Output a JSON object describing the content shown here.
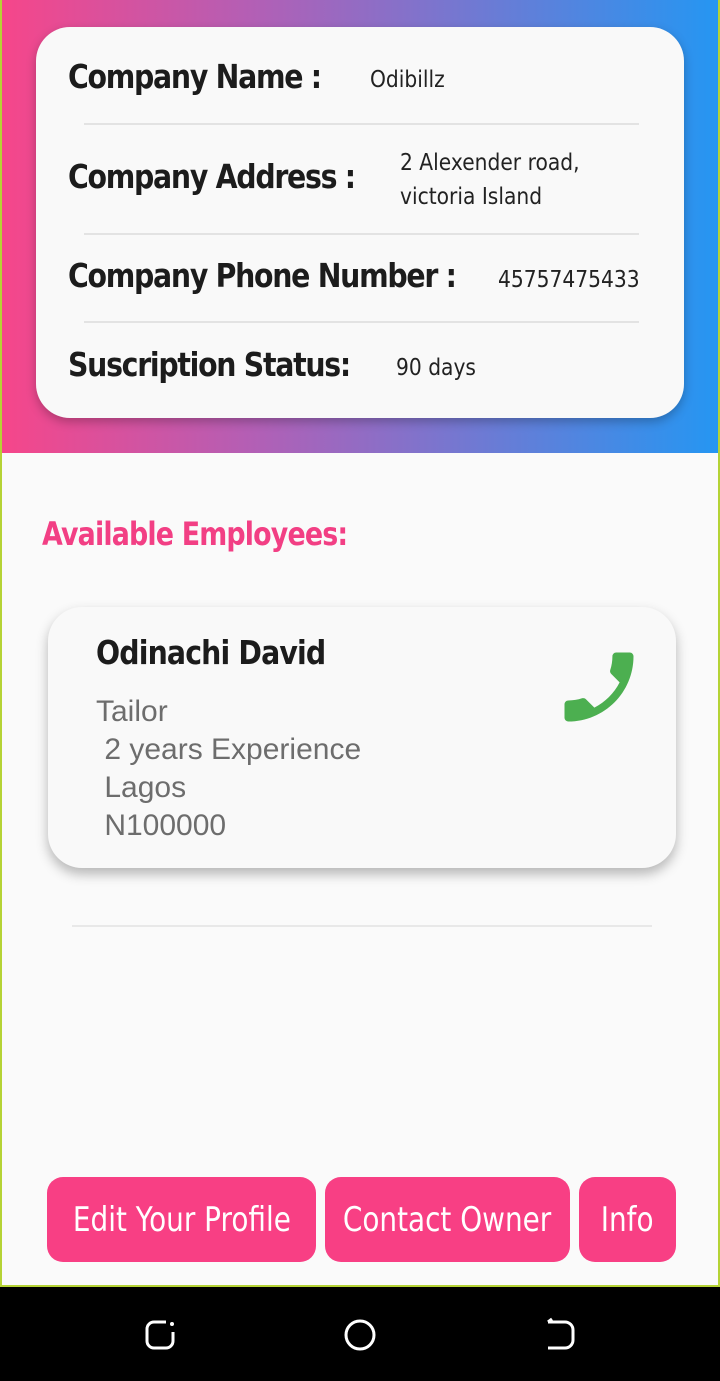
{
  "company": {
    "name_label": "Company Name :",
    "name_value": "Odibillz",
    "address_label": "Company Address :",
    "address_line1": "2 Alexender road,",
    "address_line2": "victoria Island",
    "phone_label": "Company Phone Number :",
    "phone_value": "45757475433",
    "subscription_label": "Suscription Status:",
    "subscription_value": "90 days"
  },
  "employees_section": {
    "title": "Available Employees:",
    "employees": [
      {
        "name": "Odinachi David",
        "role": "Tailor",
        "experience": " 2 years Experience",
        "location": " Lagos",
        "salary": " N100000",
        "call_icon": "phone-icon"
      }
    ]
  },
  "actions": {
    "edit_profile": "Edit Your Profile",
    "contact_owner": "Contact Owner",
    "info": "Info"
  },
  "nav": {
    "recent_icon": "recent-apps-icon",
    "home_icon": "home-icon",
    "back_icon": "back-icon"
  },
  "colors": {
    "accent_pink": "#f83f84",
    "gradient_start": "#f6468a",
    "gradient_end": "#2596f2",
    "call_green": "#4caf50",
    "frame_border": "#b5d335"
  }
}
